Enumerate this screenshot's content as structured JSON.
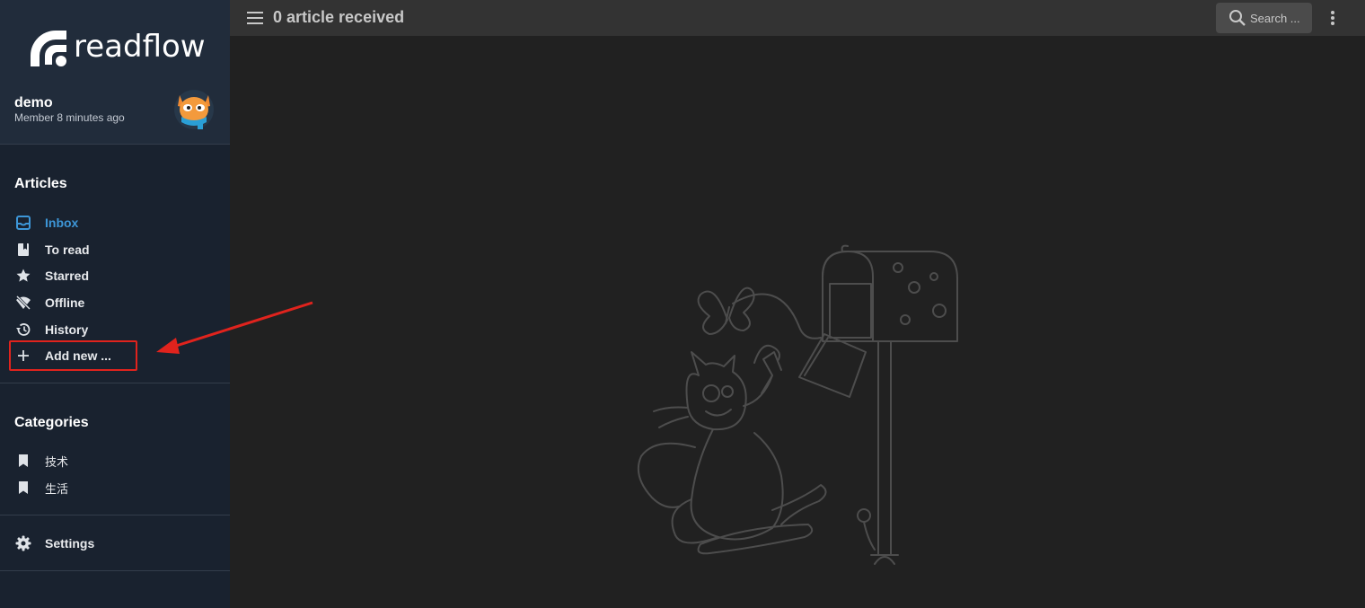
{
  "app": {
    "name": "readflow"
  },
  "user": {
    "name": "demo",
    "member_since": "Member 8 minutes ago"
  },
  "articles": {
    "title": "Articles",
    "items": [
      {
        "label": "Inbox",
        "icon": "inbox-icon",
        "active": true
      },
      {
        "label": "To read",
        "icon": "bookmark-book-icon"
      },
      {
        "label": "Starred",
        "icon": "star-icon"
      },
      {
        "label": "Offline",
        "icon": "wifi-off-icon"
      },
      {
        "label": "History",
        "icon": "history-icon"
      },
      {
        "label": "Add new ...",
        "icon": "plus-icon"
      }
    ]
  },
  "categories": {
    "title": "Categories",
    "items": [
      {
        "label": "技术",
        "icon": "bookmark-icon"
      },
      {
        "label": "生活",
        "icon": "bookmark-icon"
      }
    ]
  },
  "settings": {
    "label": "Settings",
    "icon": "gear-icon"
  },
  "header": {
    "title": "0 article received",
    "search_placeholder": "Search ..."
  },
  "colors": {
    "accent": "#3d96d7",
    "highlight": "#e0231d",
    "sidebar": "#19222f",
    "topbar": "#333333"
  }
}
